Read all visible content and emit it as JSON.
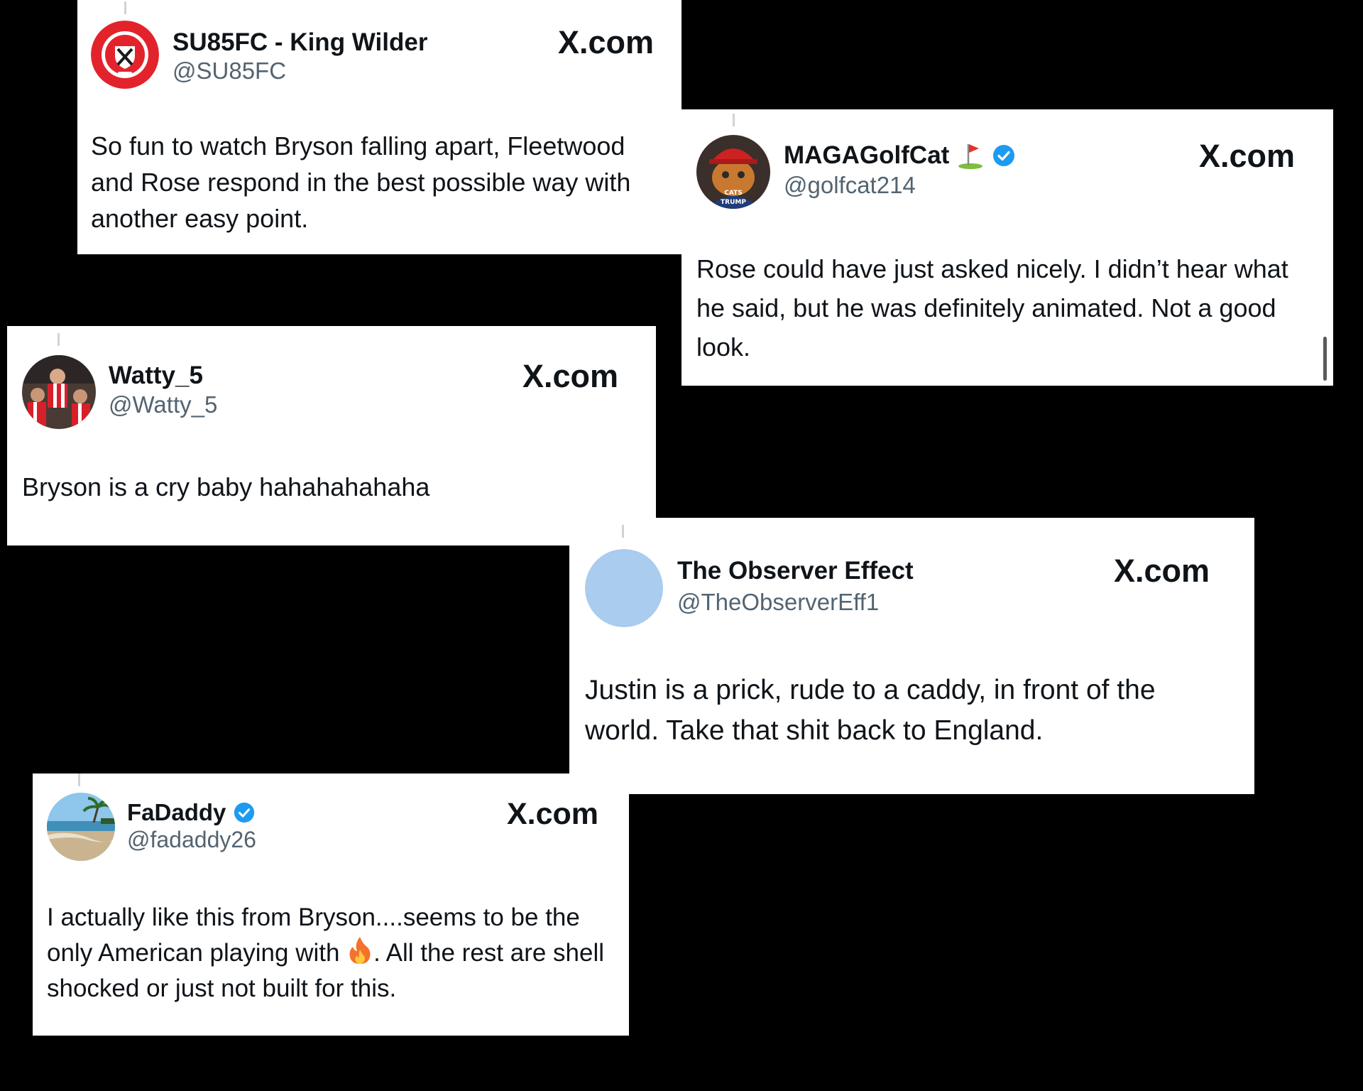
{
  "site_label": "X.com",
  "tweets": [
    {
      "display_name": "SU85FC - King Wilder",
      "handle": "@SU85FC",
      "text": "So fun to watch Bryson falling apart, Fleetwood and Rose respond in the best possible way with another easy point.",
      "avatar_icon": "sheffield-united-crest"
    },
    {
      "display_name": "MAGAGolfCat",
      "handle": "@golfcat214",
      "verified": true,
      "name_emoji_icon": "golf-flag-icon",
      "text": "Rose could have just asked nicely. I didn’t hear what he said, but he was definitely animated. Not a good look.",
      "avatar_icon": "cat-in-red-cap",
      "avatar_shirt_text": "CATS FOR TRUMP"
    },
    {
      "display_name": "Watty_5",
      "handle": "@Watty_5",
      "text": "Bryson is a cry baby hahahahahaha",
      "avatar_icon": "football-celebration-photo"
    },
    {
      "display_name": "The Observer Effect",
      "handle": "@TheObserverEff1",
      "text": "Justin is a prick, rude to a caddy, in front of the world. Take that shit back to England.",
      "avatar_icon": "plain-light-blue-avatar"
    },
    {
      "display_name": "FaDaddy",
      "handle": "@fadaddy26",
      "verified": true,
      "text_before_emoji": "I actually like this from Bryson....seems to be the only American playing with ",
      "text_emoji_icon": "fire-icon",
      "text_after_emoji": ". All the rest are shell shocked or just not built for this.",
      "avatar_icon": "beach-photo"
    }
  ],
  "colors": {
    "background": "#000000",
    "card": "#ffffff",
    "name": "#0f1419",
    "handle": "#536471",
    "verified_blue": "#1d9bf0"
  }
}
